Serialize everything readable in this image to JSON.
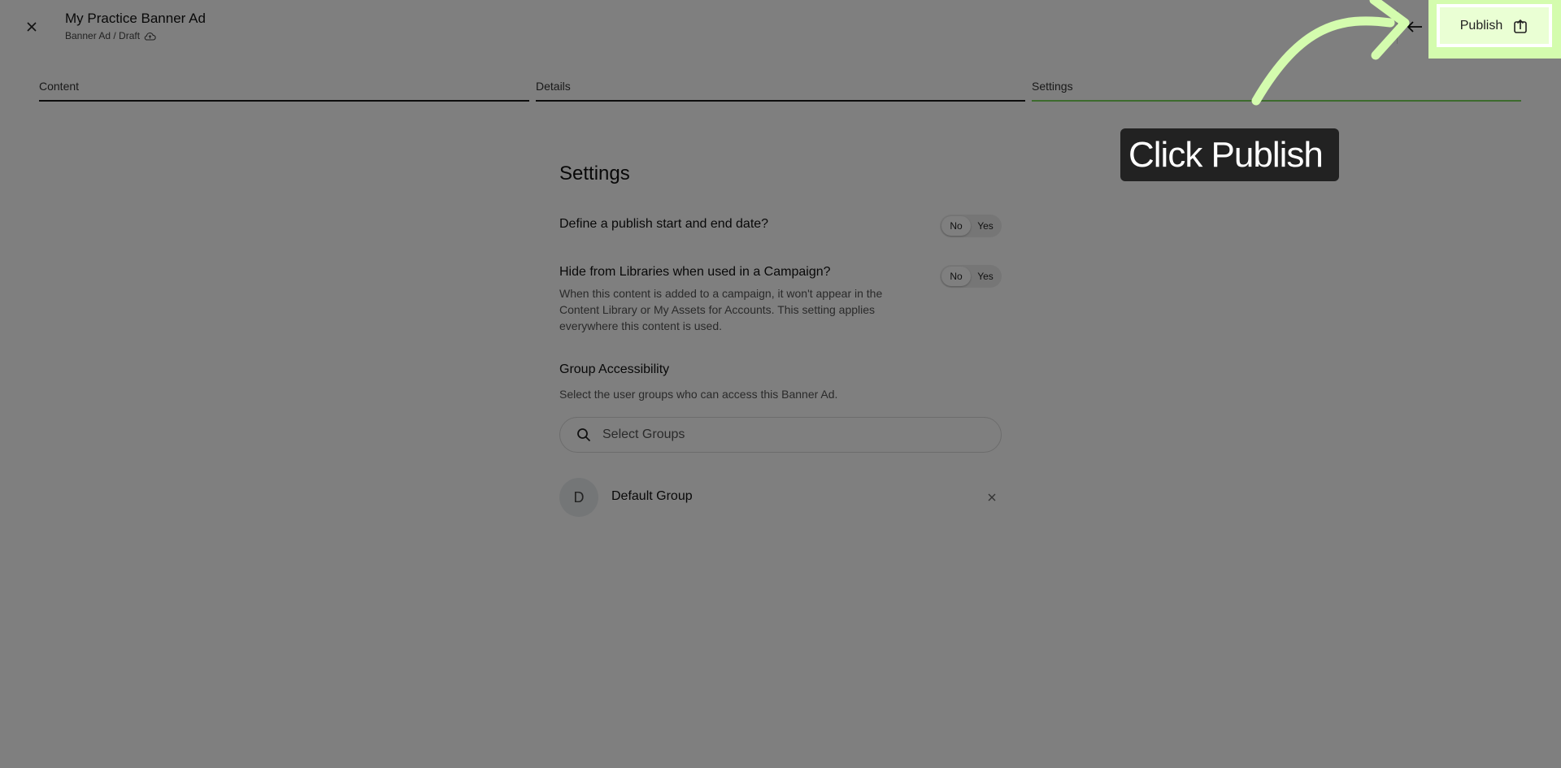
{
  "header": {
    "title": "My Practice Banner Ad",
    "breadcrumb": "Banner Ad / Draft",
    "publish_label": "Publish"
  },
  "tabs": [
    {
      "label": "Content",
      "active": false
    },
    {
      "label": "Details",
      "active": false
    },
    {
      "label": "Settings",
      "active": true
    }
  ],
  "settings": {
    "title": "Settings",
    "publish_dates": {
      "label": "Define a publish start and end date?",
      "options": [
        "No",
        "Yes"
      ],
      "selected": "No"
    },
    "hide_libraries": {
      "label": "Hide from Libraries when used in a Campaign?",
      "description": "When this content is added to a campaign, it won't appear in the Content Library or My Assets for Accounts. This setting applies everywhere this content is used.",
      "options": [
        "No",
        "Yes"
      ],
      "selected": "No"
    },
    "group_access": {
      "label": "Group Accessibility",
      "description": "Select the user groups who can access this Banner Ad.",
      "search_placeholder": "Select Groups",
      "groups": [
        {
          "initial": "D",
          "name": "Default Group"
        }
      ]
    }
  },
  "overlay": {
    "callout_text": "Click Publish",
    "highlight_color": "#d4fcae",
    "arrow_color": "#d4fcae"
  },
  "colors": {
    "active_tab_underline": "#7bd75a",
    "publish_button_bg": "#eaffd4"
  }
}
